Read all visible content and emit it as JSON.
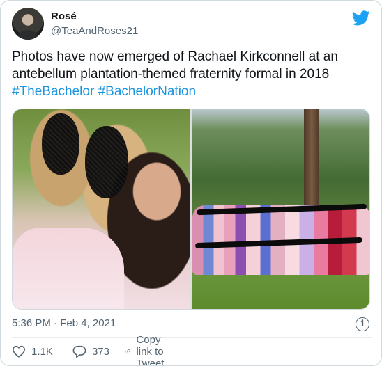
{
  "tweet": {
    "author": {
      "name": "Rosé",
      "handle": "@TeaAndRoses21"
    },
    "text_lines": [
      "Photos have now emerged of Rachael Kirkconnell at an",
      "antebellum plantation-themed fraternity formal in 2018"
    ],
    "hashtags": [
      "#TheBachelor",
      "#BachelorNation"
    ],
    "timestamp": "5:36 PM · Feb 4, 2021",
    "actions": {
      "likes": "1.1K",
      "replies": "373",
      "copy_link_label": "Copy link to Tweet"
    }
  },
  "colors": {
    "brand_blue": "#1da1f2",
    "hashtag": "#1b95e0",
    "muted": "#536471"
  },
  "icons": [
    "twitter-bird-icon",
    "info-icon",
    "heart-icon",
    "reply-icon",
    "link-icon"
  ]
}
